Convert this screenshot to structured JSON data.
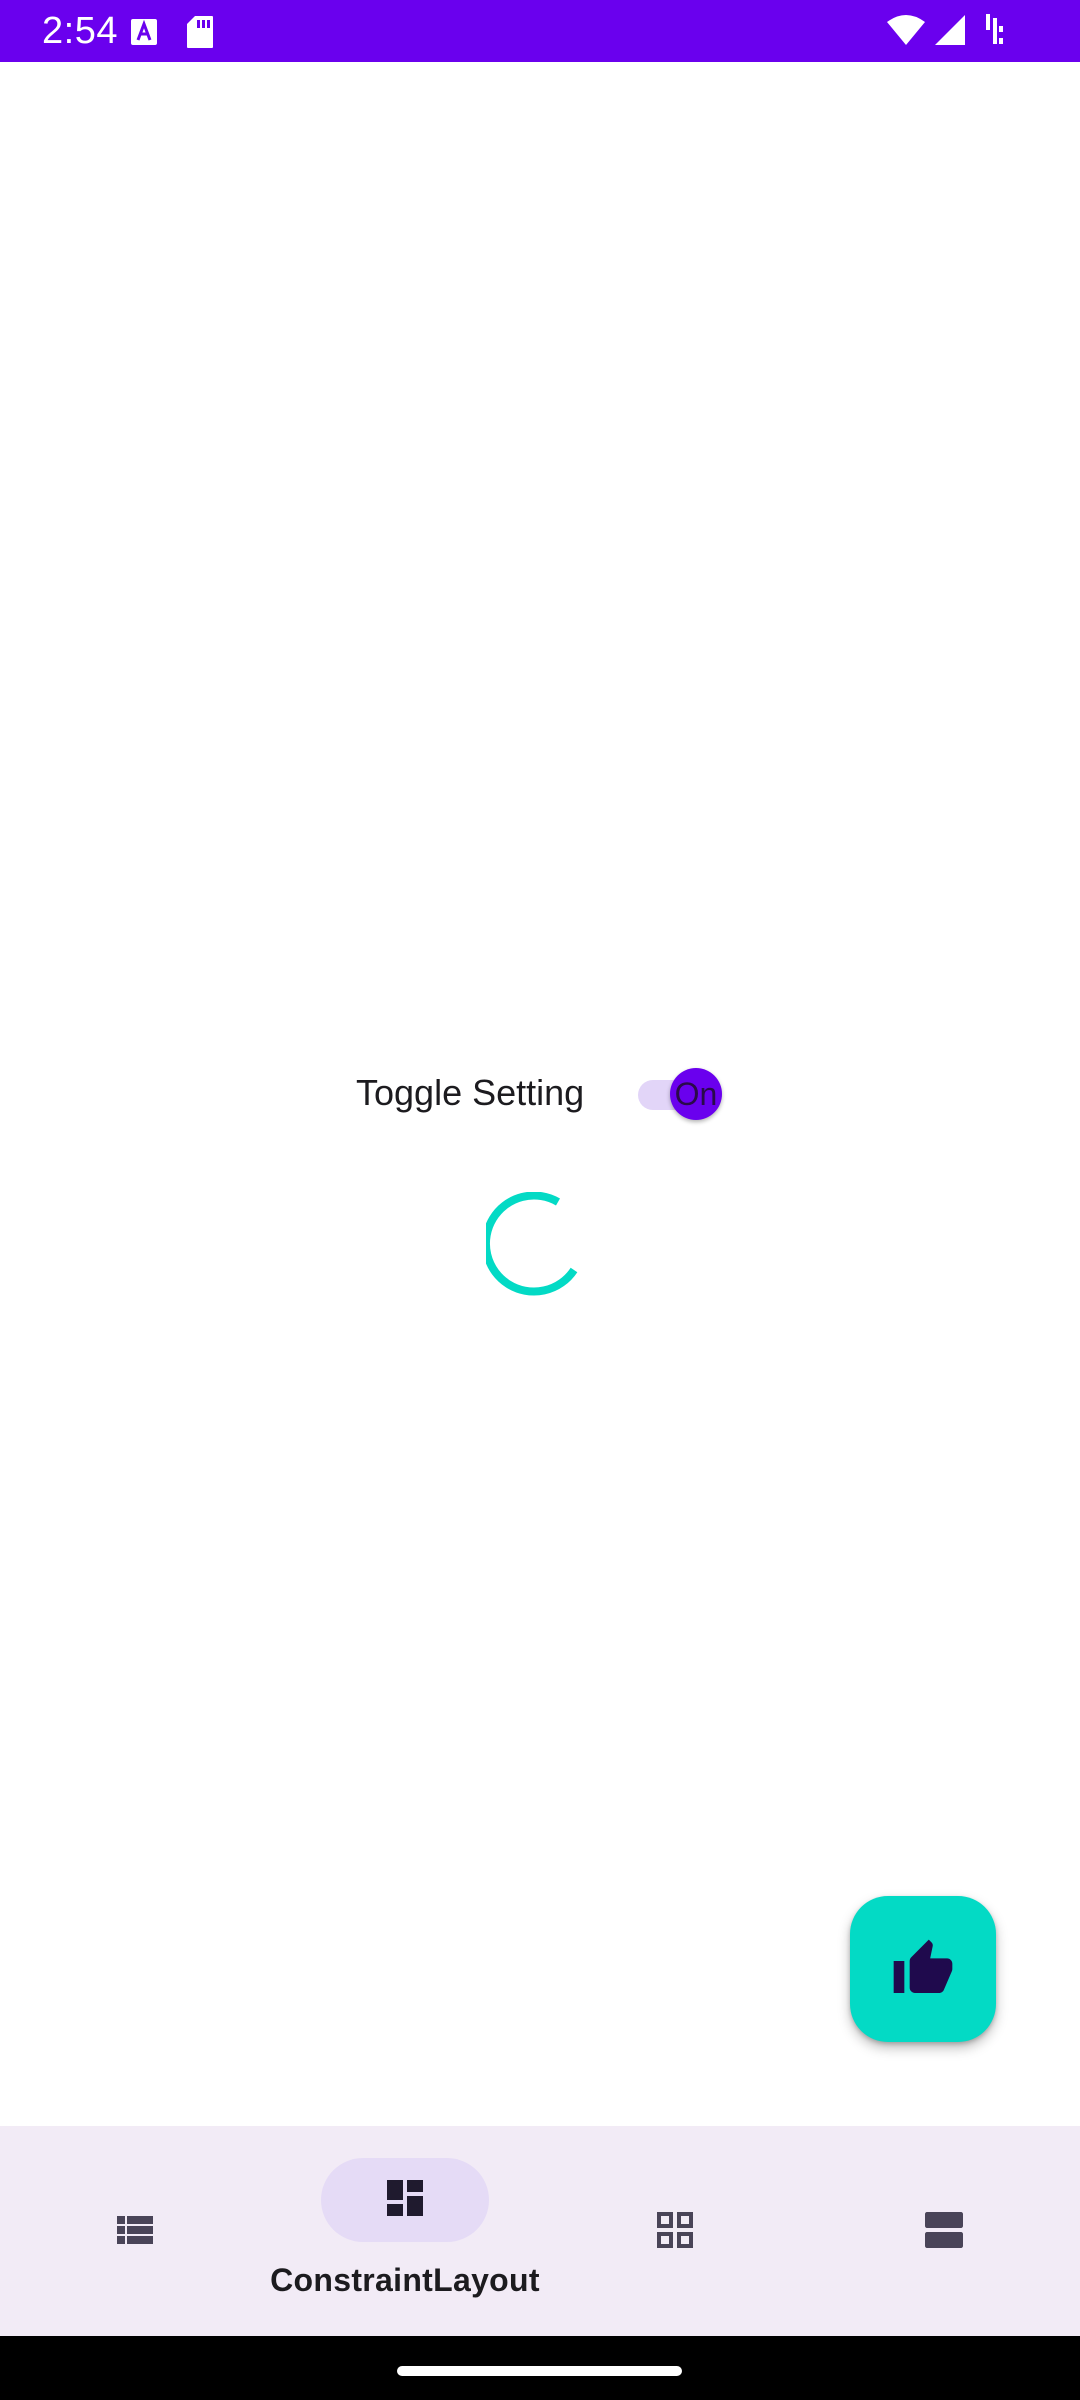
{
  "status_bar": {
    "time": "2:54",
    "background": "#6a00ee",
    "icons": [
      "font-a-icon",
      "sd-card-icon",
      "wifi-icon",
      "signal-icon",
      "battery-icon"
    ]
  },
  "settings": {
    "toggle_label": "Toggle Setting",
    "toggle_state": "On",
    "toggle_on": true
  },
  "loading": {
    "indicator": "circular-progress",
    "color": "#03dac5"
  },
  "fab": {
    "icon": "thumb-up-icon",
    "color": "#03dac5"
  },
  "bottom_nav": {
    "selected_index": 1,
    "items": [
      {
        "icon": "list-icon",
        "label": ""
      },
      {
        "icon": "dashboard-icon",
        "label": "ConstraintLayout"
      },
      {
        "icon": "grid-icon",
        "label": ""
      },
      {
        "icon": "view-agenda-icon",
        "label": ""
      }
    ]
  },
  "colors": {
    "primary": "#6a00ee",
    "secondary": "#03dac5",
    "nav_background": "#f2ebf6",
    "nav_indicator": "#e5dbf6"
  }
}
